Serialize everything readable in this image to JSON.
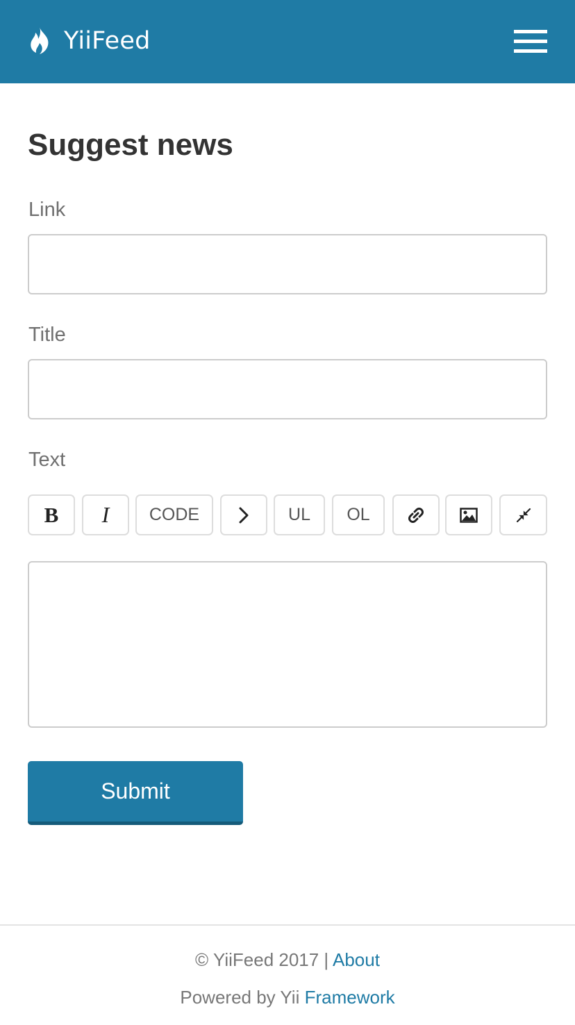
{
  "navbar": {
    "brand_name": "YiiFeed",
    "brand_icon": "flame-icon",
    "menu_icon": "hamburger-menu-icon",
    "background_color": "#1f7ba5"
  },
  "form": {
    "title": "Suggest news",
    "link_label": "Link",
    "link_value": "",
    "title_label": "Title",
    "title_value": "",
    "text_label": "Text",
    "text_value": "",
    "toolbar": {
      "bold": "B",
      "italic": "I",
      "code": "CODE",
      "blockquote_icon": "chevron-right-icon",
      "ul": "UL",
      "ol": "OL",
      "link_icon": "link-icon",
      "image_icon": "image-icon",
      "collapse_icon": "compress-icon"
    },
    "submit_label": "Submit",
    "accent_color": "#1f7ba5"
  },
  "footer": {
    "copyright": "© YiiFeed 2017 |",
    "about_link": "About",
    "powered_prefix": "Powered by Yii",
    "framework_link": "Framework"
  }
}
